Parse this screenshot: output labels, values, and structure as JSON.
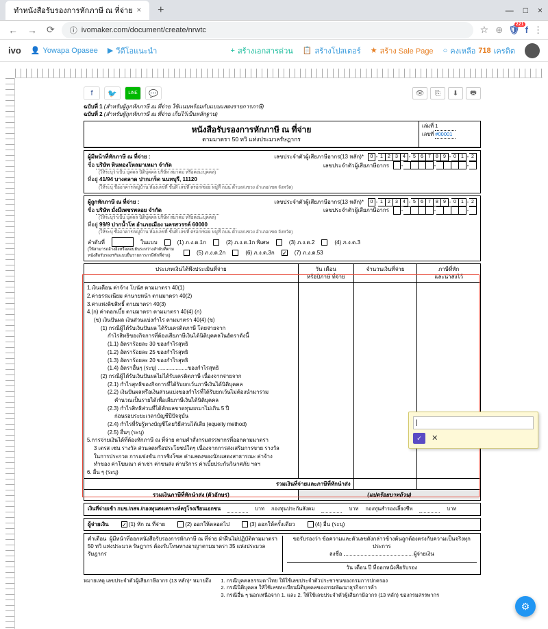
{
  "browser": {
    "tab_title": "ทำหนังสือรับรองการหักภาษี ณ ที่จ่าย",
    "url": "ivomaker.com/document/create/nrwtc",
    "new_tab": "+",
    "minimize": "—",
    "maximize": "□",
    "close": "×",
    "back": "←",
    "forward": "→",
    "reload": "⟳",
    "lock": "ⓘ",
    "star": "☆",
    "notif_badge": "221"
  },
  "toolbar": {
    "logo": "ivo",
    "user": "Yowapa Opasee",
    "video": "วีดีโอแนะนำ",
    "create_doc": "สร้างเอกสารด่วน",
    "create_poster": "สร้างโปสเตอร์",
    "create_sale": "สร้าง Sale Page",
    "credits_label": "คงเหลือ",
    "credits_value": "718",
    "credits_unit": "เครดิต"
  },
  "share": {
    "fb": "f",
    "tw": "🐦",
    "line": "LINE",
    "msg": "💬"
  },
  "doc_btns": {
    "preview": "👁",
    "copy": "⎘",
    "download": "⬇",
    "print": "🖶"
  },
  "form": {
    "copy1": "ฉบับที่ 1 (สำหรับผู้ถูกหักภาษี ณ ที่จ่าย ใช้แนบพร้อมกับแบบแสดงรายการภาษี)",
    "copy2": "ฉบับที่ 2 (สำหรับผู้ถูกหักภาษี ณ ที่จ่าย เก็บไว้เป็นหลักฐาน)",
    "title": "หนังสือรับรองการหักภาษี ณ ที่จ่าย",
    "subtitle": "ตามมาตรา 50 ทวิ แห่งประมวลรัษฎากร",
    "book_no_label": "เล่มที่",
    "book_no": "1",
    "doc_no_label": "เลขที่",
    "doc_no": "#00001",
    "payer_heading": "ผู้มีหน้าที่หักภาษี ณ ที่จ่าย :",
    "payee_heading": "ผู้ถูกหักภาษี ณ ที่จ่าย :",
    "name_label": "ชื่อ",
    "addr_label": "ที่อยู่",
    "name_hint": "(ให้ระบุว่าเป็น บุคคล นิติบุคคล บริษัท สมาคม หรือคณะบุคคล)",
    "addr_hint": "(ให้ระบุ ชื่ออาคาร/หมู่บ้าน ห้องเลขที่ ชั้นที่ เลขที่ ตรอก/ซอย หมู่ที่ ถนน ตำบล/แขวง อำเภอ/เขต จังหวัด)",
    "payer_name": "บริษัท หินทองโหลมาเหมา จํากัด",
    "payer_addr": "41/94 บางตลาด ปากเกร็ด นนทบุรี, 11120",
    "payee_name": "บริษัท มั่งมีเพชรพลอย จํากัด",
    "payee_addr": "99/9 ปากน้ำโพ อำเภอเมือง นครสวรรค์ 60000",
    "tax13_label": "เลขประจำตัวผู้เสียภาษีอากร(13 หลัก)*",
    "taxid_label": "เลขประจำตัวผู้เสียภาษีอากร",
    "tax13_digits": [
      "0",
      "1",
      "2",
      "3",
      "4",
      "5",
      "6",
      "7",
      "8",
      "9",
      "0",
      "1",
      "2"
    ],
    "seq_label": "ลำดับที่",
    "seq_box": "",
    "in_form_label": "ในแบบ",
    "seq_hint": "(ให้สามารถอ้างอิงหรือสอบยันระหว่างลำดับที่ตามหนังสือรับรองฯกับแบบยื่นรายการภาษีหักที่จ่าย)",
    "f1": "(1) ภ.ง.ด.1ก",
    "f2": "(2) ภ.ง.ด.1ก พิเศษ",
    "f3": "(3) ภ.ง.ด.2",
    "f4": "(4) ภ.ง.ด.3",
    "f5": "(5) ภ.ง.ด.2ก",
    "f6": "(6) ภ.ง.ด.3ก",
    "f7": "(7) ภ.ง.ด.53",
    "th_type": "ประเภทเงินได้พึงประเมินที่จ่าย",
    "th_date": "วัน เดือน\nหรือปีภาษี ที่จ่าย",
    "th_amount": "จำนวนเงินที่จ่าย",
    "th_tax": "ภาษีที่หัก\nและนำส่งไว้",
    "lines": {
      "l1": "1.เงินเดือน ค่าจ้าง โบนัส ตามมาตรา 40(1)",
      "l2": "2.ค่าธรรมเนียม ค่านายหน้า ตามมาตรา 40(2)",
      "l3": "3.ค่าแห่งลิขสิทธิ์ ตามมาตรา 40(3)",
      "l4": "4.(ก) ค่าดอกเบี้ย ตามมาตรา ตามมาตรา 40(4) (ก)",
      "l4b": "(ข) เงินปันผล เงินส่วนแบ่งกำไร ตามมาตรา 40(4) (ข)",
      "l4b1": "(1) กรณีผู้ได้รับเงินปันผล ได้รับเครดิตภาษี โดยจ่ายจาก",
      "l4b1x": "กำไรสิทธิของกิจการที่ต้องเสียภาษีเงินได้นิติบุคคลในอัตราดังนี้",
      "l4b11": "(1.1) อัตราร้อยละ 30 ของกำไรสุทธิ",
      "l4b12": "(1.2) อัตราร้อยละ 25 ของกำไรสุทธิ",
      "l4b13": "(1.3) อัตราร้อยละ 20 ของกำไรสุทธิ",
      "l4b14": "(1.4) อัตราอื่นๆ (ระบุ) ....................ของกำไรสุทธิ",
      "l4b2": "(2) กรณีผู้ได้รับเงินปันผลไม่ได้รับเครดิตภาษี เนื่องจากจ่ายจาก",
      "l4b21": "(2.1) กำไรสุทธิของกิจการที่ได้รับยกเว้นภาษีเงินได้นิติบุคคล",
      "l4b22": "(2.2) เงินปันผลหรือเงินส่วนแบ่งของกำไรที่ได้รับยกเว้นไม่ต้องนำมารวม",
      "l4b22x": "คำนวณเป็นรายได้เพื่อเสียภาษีเงินได้นิติบุคคล",
      "l4b23": "(2.3) กำไรสิทธิส่วนที่ได้หักผลขาดทุนยกมาไม่เกิน 5 ปี",
      "l4b23x": "ก่อนรอบระยะเวลาบัญชีปีปัจจุบัน",
      "l4b24": "(2.4) กำไรที่รับรู้ทางบัญชีโดยวิธีส่วนได้เสีย (equeity method)",
      "l4b25": "(2.5) อื่นๆ (ระบุ)",
      "l5": "5.การจ่ายเงินได้ที่ต้องหักภาษี ณ ที่จ่าย ตามคำสั่งกรมสรรพากรที่ออกตามมาตรา",
      "l5a": "3 เตรส เช่น รางวัล ส่วนลดหรือประโยชน์ใดๆ เนื่องจากการส่งเสริมการขาย รางวัล",
      "l5b": "ในการประกวด การแข่งขัน การชิงโชค ค่าแสดงของนักแสดงสาธารณะ ค่าจ้าง",
      "l5c": "ทำของ ค่าโฆษณา ค่าเช่า ค่าขนส่ง ค่าบริการ ค่าเบี้ยประกันวินาศภัย ฯลฯ",
      "l6": "6. อื่น ๆ (ระบุ)"
    },
    "sum_label": "รวมเงินที่จ่ายและภาษีที่หักนำส่ง",
    "sum_words_label": "รวมเงินภาษีที่หักนำส่ง (ตัวอักษร)",
    "sum_words_hint": "(แปดร้อยบาทถ้วน)",
    "payin_label": "เงินที่จ่ายเข้า กบข./กสจ./กองทุนสงเคราะห์ครูโรงเรียนเอกชน",
    "payin_fund1": "กองทุนประกันสังคม",
    "payin_fund2": "กองทุนสำรองเลี้ยงชีพ",
    "baht": "บาท",
    "payer_sign_heading": "ผู้จ่ายเงิน",
    "opt1": "(1) หัก ณ ที่จ่าย",
    "opt2": "(2) ออกให้ตลอดไป",
    "opt3": "(3) ออกให้ครั้งเดียว",
    "opt4": "(4) อื่น (ระบุ)",
    "warning_label": "คำเตือน",
    "warning_text": "ผู้มีหน้าที่ออกหนังสือรับรองการหักภาษี ณ ที่จ่าย ฝ่าฝืนไม่ปฏิบัติตามมาตรา 50 ทวิ แห่งประมวล รัษฎากร ต้องรับโทษทางอาญาตามมาตรา 35 แห่งประมวลรัษฎากร",
    "cert_text": "ขอรับรองว่า ข้อความและตัวเลขดังกล่าวข้างต้นถูกต้องตรงกับความเป็นจริงทุกประการ",
    "sign_label": "ลงชื่อ",
    "sign_role": "ผู้จ่ายเงิน",
    "date_label": "วัน เดือน ปี ที่ออกหนังสือรับรอง",
    "remark_label": "หมายเหตุ เลขประจำตัวผู้เสียภาษีอากร (13 หลัก)* หมายถึง",
    "remark1": "1. กรณีบุคคลธรรมดาไทย ให้ใช้เลขประจำตัวประชาชนของกรมการปกครอง",
    "remark2": "2. กรณีนิติบุคคล ให้ใช้เลขทะเบียนนิติบุคคลของกรมพัฒนาธุรกิจการค้า",
    "remark3": "3. กรณีอื่น ๆ นอกเหนือจาก 1. และ 2. ให้ใช้เลขประจำตัวผู้เสียภาษีอากร (13 หลัก) ของกรมสรรพากร"
  },
  "editor": {
    "input_value": "|",
    "ok": "✓",
    "cancel": "✕"
  },
  "fab": "⚙"
}
